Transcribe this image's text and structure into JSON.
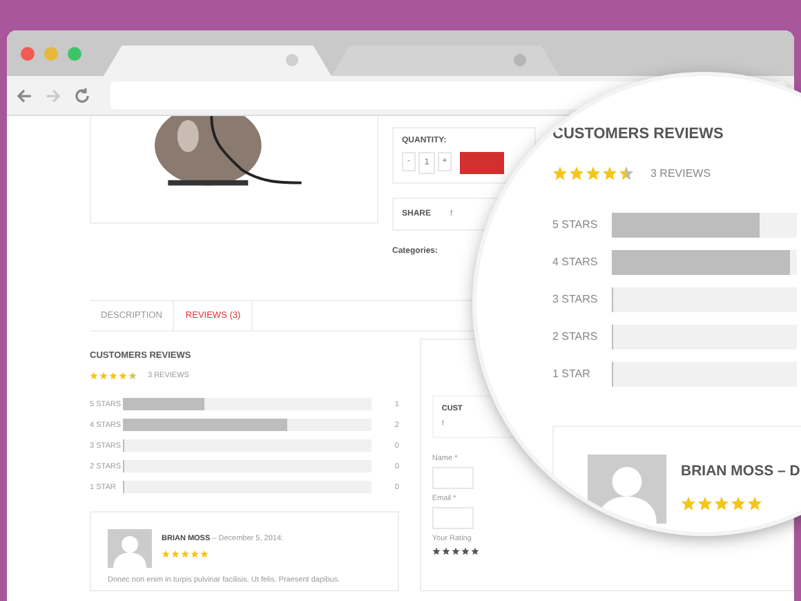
{
  "browser": {
    "tabs": [
      {
        "selected": true
      },
      {
        "selected": false
      }
    ]
  },
  "product": {
    "quantity_label": "QUANTITY:",
    "minus": "-",
    "quantity": "1",
    "plus": "+",
    "share_label": "SHARE",
    "share_icon": "f",
    "categories_label": "Categories:"
  },
  "tabs": [
    {
      "label": "DESCRIPTION",
      "selected": false
    },
    {
      "label": "REVIEWS (3)",
      "selected": true
    }
  ],
  "reviews": {
    "title": "CUSTOMERS REVIEWS",
    "stars": 4.5,
    "count": "3 REVIEWS",
    "breakdown": [
      {
        "label": "5 STARS",
        "level": 0.33,
        "count": "1"
      },
      {
        "label": "4 STARS",
        "level": 0.66,
        "count": "2"
      },
      {
        "label": "3 STARS",
        "level": 0,
        "count": "0"
      },
      {
        "label": "2 STARS",
        "level": 0,
        "count": "0"
      },
      {
        "label": "1 STAR",
        "level": 0,
        "count": "0"
      }
    ],
    "review": {
      "author": "BRIAN MOSS",
      "date": " – December 5, 2014:",
      "stars": 5,
      "text": "Donec non enim in turpis pulvinar facilisis. Ut felis. Praesent dapibus."
    }
  },
  "form": {
    "heading": "CUST",
    "share_icon": "f",
    "fields": [
      {
        "label": "Name *"
      },
      {
        "label": "Email *"
      }
    ],
    "rating_label": "Your Rating"
  },
  "magnifier": {
    "title": "CUSTOMERS REVIEWS",
    "stars": 4.5,
    "count": "3 REVIEWS",
    "breakdown": [
      {
        "label": "5 STARS",
        "level": 0.8
      },
      {
        "label": "4 STARS",
        "level": 0.96
      },
      {
        "label": "3 STARS",
        "level": 0
      },
      {
        "label": "2 STARS",
        "level": 0
      },
      {
        "label": "1 STAR",
        "level": 0
      }
    ],
    "review": {
      "author": "BRIAN MOSS – D",
      "stars": 5
    }
  }
}
